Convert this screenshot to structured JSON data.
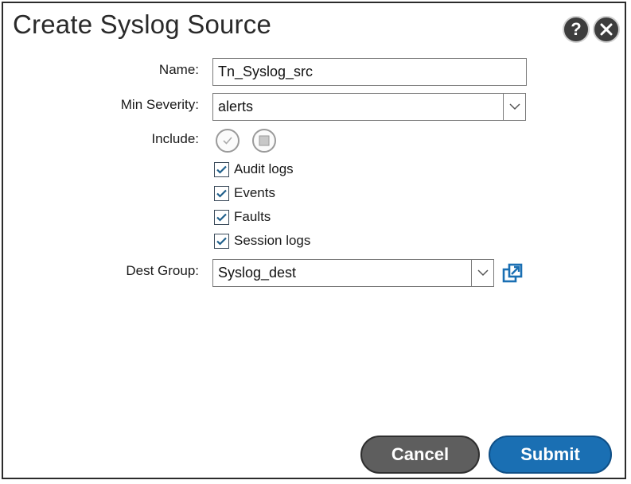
{
  "dialog": {
    "title": "Create Syslog Source",
    "help_icon": "question-icon",
    "close_icon": "close-icon"
  },
  "form": {
    "name_label": "Name:",
    "name_value": "Tn_Syslog_src",
    "severity_label": "Min Severity:",
    "severity_value": "alerts",
    "include_label": "Include:",
    "include_icons": [
      "select-all-icon",
      "deselect-all-icon"
    ],
    "include_options": [
      {
        "label": "Audit logs",
        "checked": true
      },
      {
        "label": "Events",
        "checked": true
      },
      {
        "label": "Faults",
        "checked": true
      },
      {
        "label": "Session logs",
        "checked": true
      }
    ],
    "dest_group_label": "Dest Group:",
    "dest_group_value": "Syslog_dest",
    "open_icon": "open-in-new-icon"
  },
  "footer": {
    "cancel_label": "Cancel",
    "submit_label": "Submit"
  },
  "colors": {
    "submit": "#1a6fb3",
    "cancel": "#5e5e5e",
    "checkbox": "#1f5f8b"
  }
}
